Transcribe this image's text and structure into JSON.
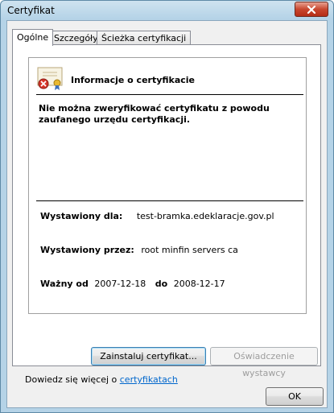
{
  "window": {
    "title": "Certyfikat"
  },
  "tabs": [
    "Ogólne",
    "Szczegóły",
    "Ścieżka certyfikacji"
  ],
  "general": {
    "header": "Informacje o certyfikacie",
    "warning_line1": "Nie można zweryfikować certyfikatu z powodu",
    "warning_line2": "zaufanego urzędu certyfikacji.",
    "issued_to_label": "Wystawiony dla:",
    "issued_to_value": "test-bramka.edeklaracje.gov.pl",
    "issued_by_label": "Wystawiony przez:",
    "issued_by_value": "root minfin servers ca",
    "valid_from_label": "Ważny od",
    "valid_from_value": "2007-12-18",
    "valid_to_label": "do",
    "valid_to_value": "2008-12-17"
  },
  "buttons": {
    "install": "Zainstaluj certyfikat...",
    "issuer_statement": "Oświadczenie wystawcy",
    "ok": "OK"
  },
  "learn_more": {
    "prefix": "Dowiedz się więcej o",
    "link": "certyfikatach"
  },
  "icons": {
    "close": "close-icon",
    "certificate": "certificate-error-icon"
  }
}
